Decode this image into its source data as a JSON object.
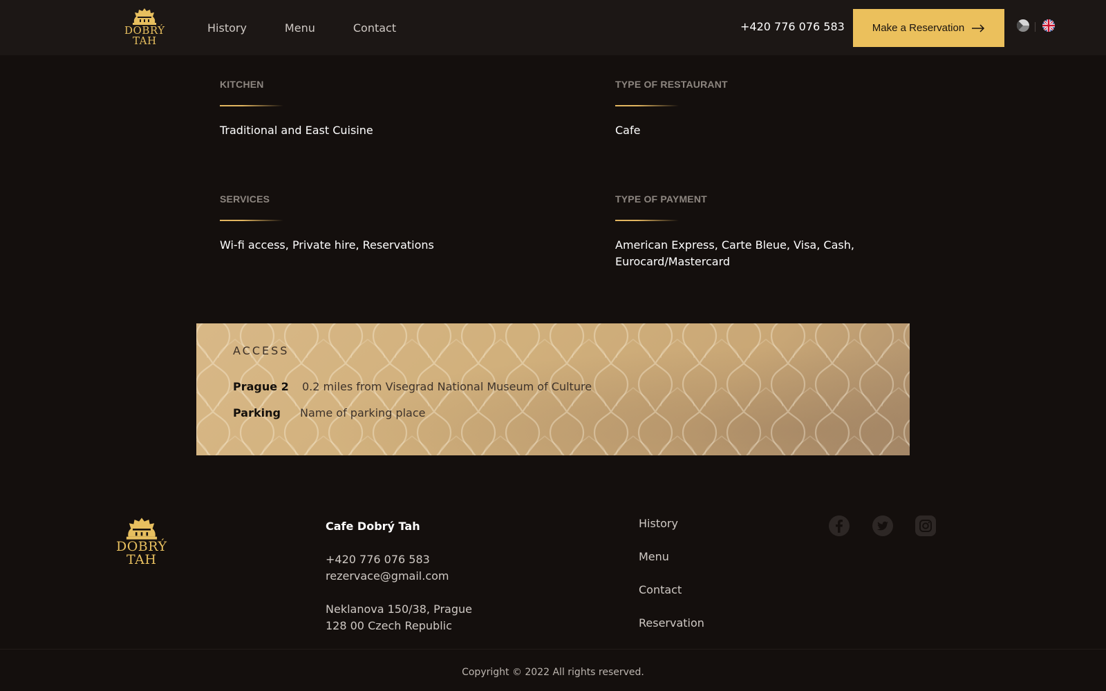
{
  "header": {
    "logo_text_1": "DOBRÝ",
    "logo_text_2": "TAH",
    "nav": [
      "History",
      "Menu",
      "Contact"
    ],
    "phone": "+420 776 076 583",
    "reserve_label": "Make a Reservation"
  },
  "info": {
    "kitchen": {
      "label": "KITCHEN",
      "value": "Traditional and East Cuisine"
    },
    "type_of_restaurant": {
      "label": "TYPE OF RESTAURANT",
      "value": "Cafe"
    },
    "services": {
      "label": "SERVICES",
      "value": "Wi-fi access, Private hire, Reservations"
    },
    "type_of_payment": {
      "label": "TYPE OF PAYMENT",
      "value_line1": "American Express, Carte Bleue, Visa, Cash,",
      "value_line2": "Eurocard/Mastercard"
    }
  },
  "access": {
    "title": "ACCESS",
    "rows": [
      {
        "key": "Prague 2",
        "value": "0.2 miles from Visegrad National Museum of Culture"
      },
      {
        "key": "Parking",
        "value": "Name of parking place"
      }
    ]
  },
  "footer": {
    "logo_text_1": "DOBRÝ",
    "logo_text_2": "TAH",
    "name": "Cafe Dobrý Tah",
    "phone": "+420 776 076 583",
    "email": "rezervace@gmail.com",
    "address_line1": "Neklanova 150/38, Prague",
    "address_line2": "128 00 Czech Republic",
    "links": [
      "History",
      "Menu",
      "Contact",
      "Reservation"
    ],
    "social": [
      "facebook-icon",
      "twitter-icon",
      "instagram-icon"
    ],
    "copyright": "Copyright © 2022 All rights reserved."
  },
  "colors": {
    "background": "#140f0d",
    "header": "#1c1715",
    "accent_gold": "#ebc05c",
    "panel_gold": "#d1b07c"
  }
}
